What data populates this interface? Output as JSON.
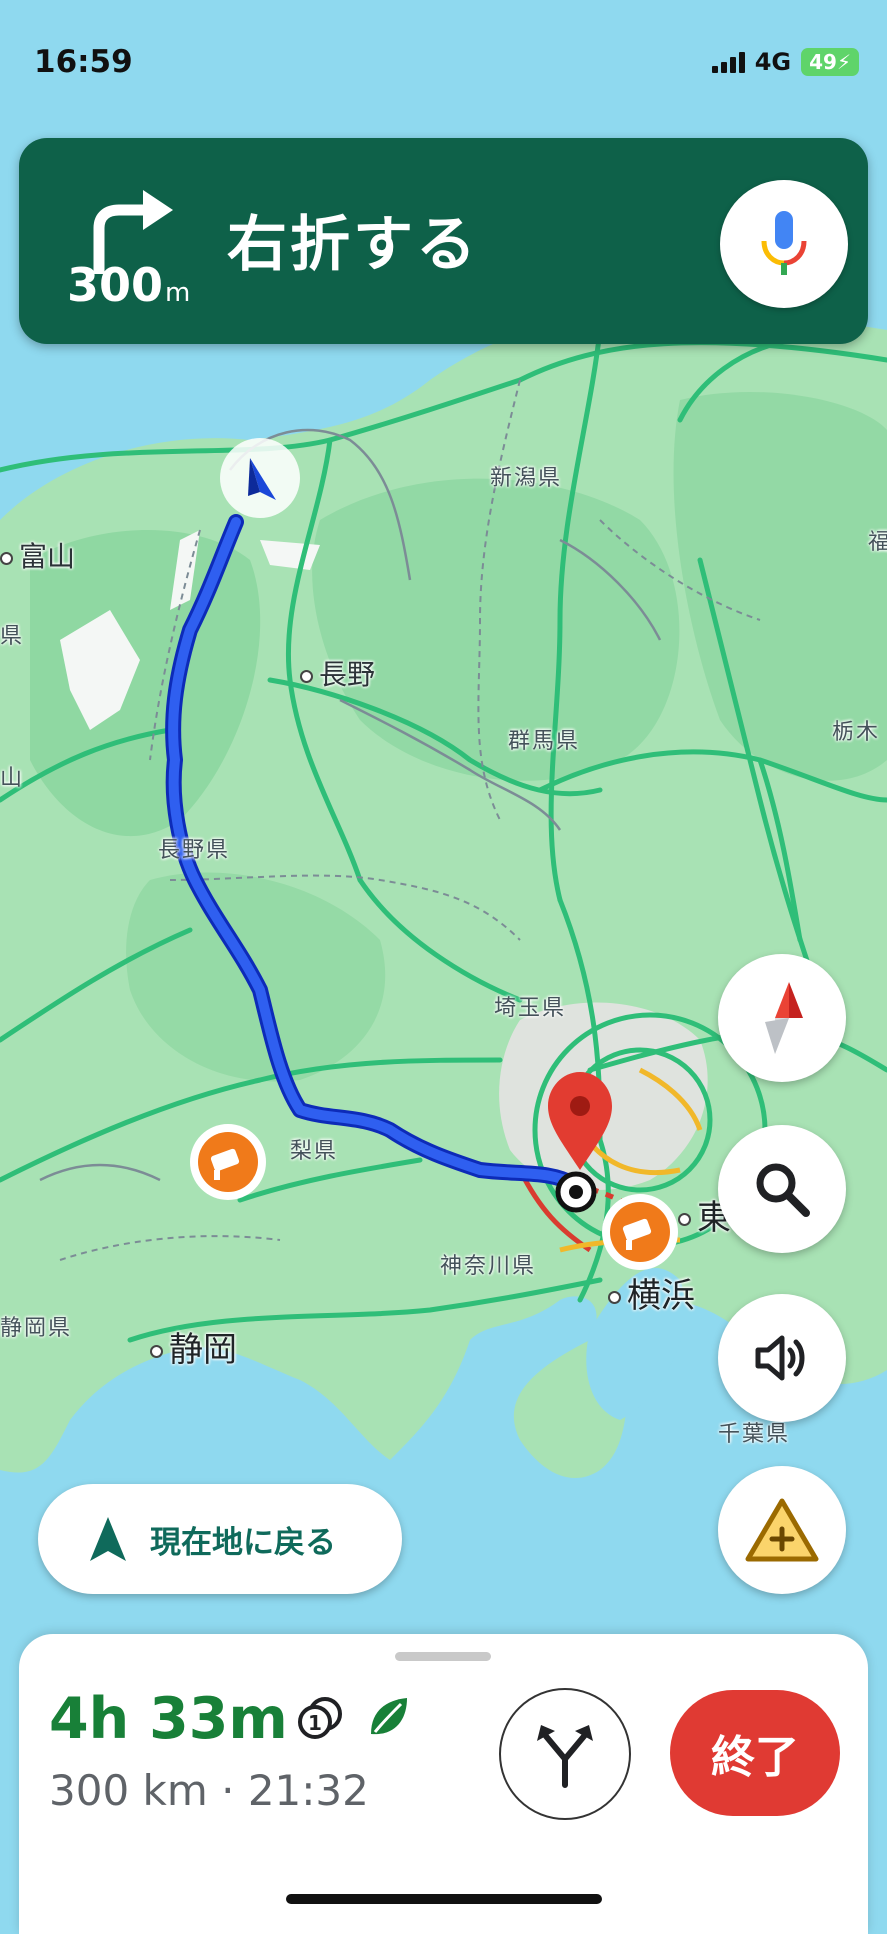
{
  "status_bar": {
    "time": "16:59",
    "network": "4G",
    "battery": "49"
  },
  "banner": {
    "instruction": "右折する",
    "distance": "300",
    "unit": "m",
    "turn_icon": "turn-right-icon",
    "mic_icon": "microphone-icon",
    "color": "#0e6149"
  },
  "map": {
    "labels": {
      "niigata_pref": "新潟県",
      "toyama": "富山",
      "nagano": "長野",
      "gunma_pref": "群馬県",
      "nagano_pref": "長野県",
      "saitama_pref": "埼玉県",
      "yamanashi_pref": "梨県",
      "kanagawa_pref": "神奈川県",
      "yokohama": "横浜",
      "shizuoka_pref": "静岡県",
      "shizuoka": "静岡",
      "tochigi": "栃木",
      "chiba_pref": "千葉県",
      "fuku": "福",
      "tokyo": "東",
      "edge_ken": "県",
      "edge_san": "山"
    },
    "route_color": "#1a3fd6",
    "road_color": "#2fbe78"
  },
  "buttons": {
    "compass_icon": "compass-icon",
    "search_icon": "search-icon",
    "sound_icon": "speaker-icon",
    "report_icon": "add-report-icon",
    "recenter_label": "現在地に戻る"
  },
  "trip": {
    "duration": "4h 33m",
    "distance": "300 km",
    "arrival": "21:32",
    "separator": " · ",
    "end_label": "終了",
    "toll_icon": "toll-icon",
    "eco_icon": "eco-leaf-icon",
    "alternate_routes_icon": "alternate-routes-icon"
  }
}
